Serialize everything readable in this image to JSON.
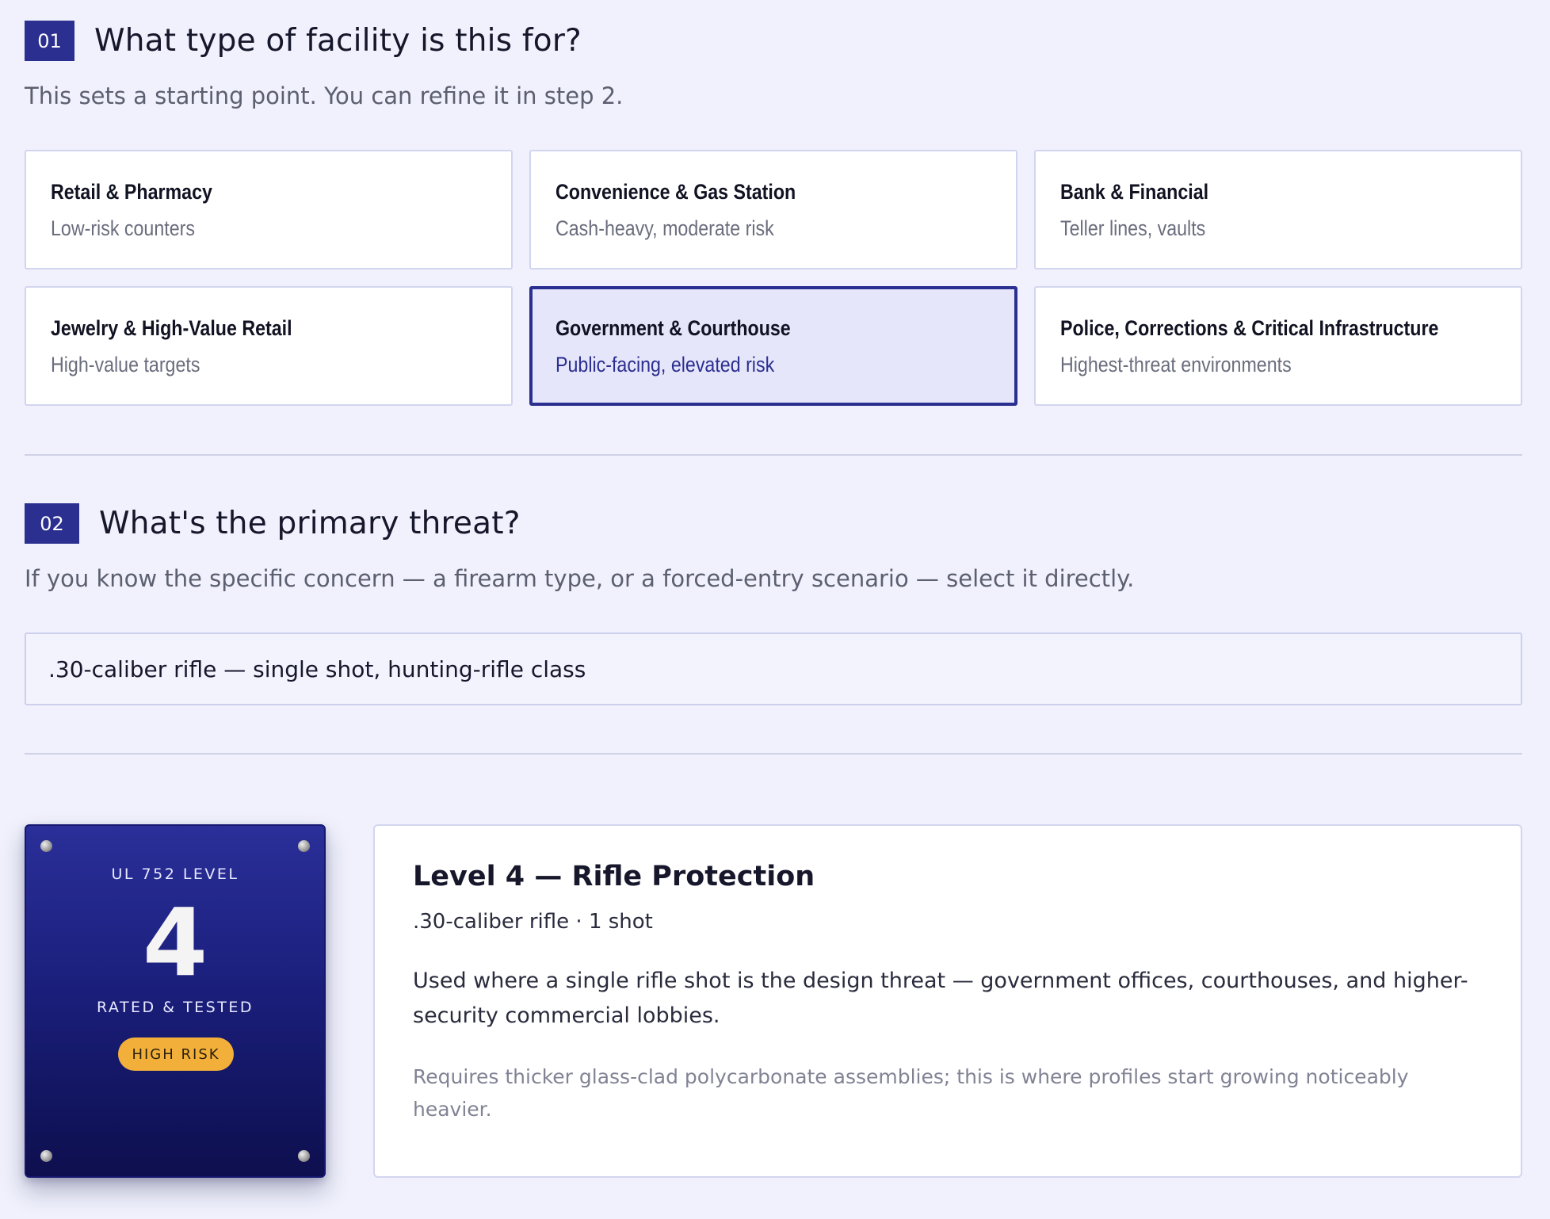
{
  "step1": {
    "number": "01",
    "title": "What type of facility is this for?",
    "subtitle": "This sets a starting point. You can refine it in step 2.",
    "options": [
      {
        "title": "Retail & Pharmacy",
        "desc": "Low-risk counters",
        "selected": false
      },
      {
        "title": "Convenience & Gas Station",
        "desc": "Cash-heavy, moderate risk",
        "selected": false
      },
      {
        "title": "Bank & Financial",
        "desc": "Teller lines, vaults",
        "selected": false
      },
      {
        "title": "Jewelry & High-Value Retail",
        "desc": "High-value targets",
        "selected": false
      },
      {
        "title": "Government & Courthouse",
        "desc": "Public-facing, elevated risk",
        "selected": true
      },
      {
        "title": "Police, Corrections & Critical Infrastructure",
        "desc": "Highest-threat environments",
        "selected": false
      }
    ]
  },
  "step2": {
    "number": "02",
    "title": "What's the primary threat?",
    "subtitle": "If you know the specific concern — a firearm type, or a forced-entry scenario — select it directly.",
    "selected_threat": ".30-caliber rifle — single shot, hunting-rifle class"
  },
  "result": {
    "badge": {
      "level_label": "UL 752 LEVEL",
      "level": "4",
      "rated_label": "RATED & TESTED",
      "risk": "HIGH RISK"
    },
    "title": "Level 4 — Rifle Protection",
    "spec": ".30-caliber rifle · 1 shot",
    "body": "Used where a single rifle shot is the design threat — government offices, courthouses, and higher-security commercial lobbies.",
    "note": "Requires thicker glass-clad polycarbonate assemblies; this is where profiles start growing noticeably heavier."
  },
  "colors": {
    "accent": "#2b2f8f",
    "background": "#f0f1fc",
    "risk_badge": "#f2b03b"
  }
}
